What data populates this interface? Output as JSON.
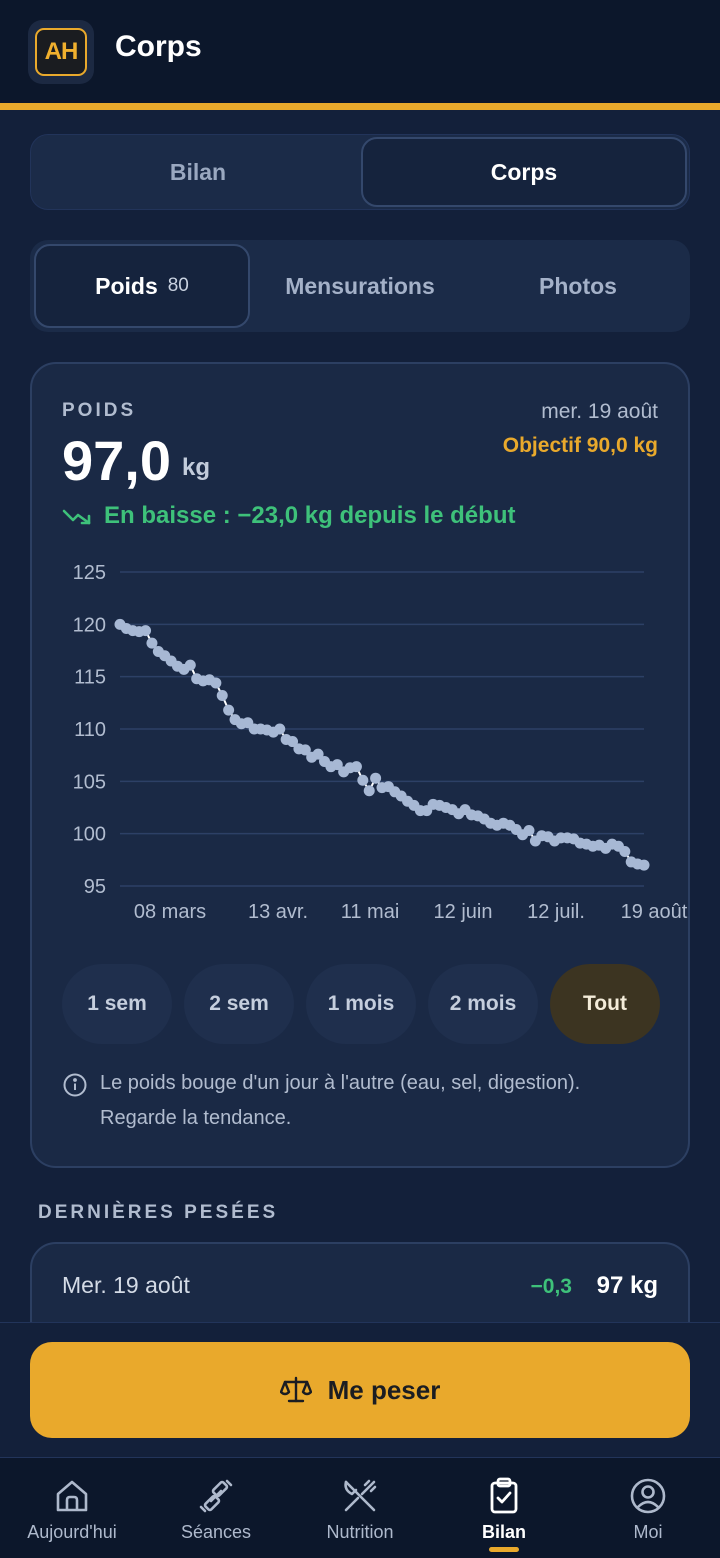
{
  "header": {
    "logo_text": "AH",
    "title": "Corps"
  },
  "top_tabs": [
    {
      "label": "Bilan",
      "active": false
    },
    {
      "label": "Corps",
      "active": true
    }
  ],
  "sub_tabs": [
    {
      "label": "Poids",
      "count": "80",
      "active": true
    },
    {
      "label": "Mensurations",
      "active": false
    },
    {
      "label": "Photos",
      "active": false
    }
  ],
  "card": {
    "label": "POIDS",
    "value": "97,0",
    "unit": "kg",
    "date": "mer. 19 août",
    "goal": "Objectif 90,0 kg",
    "trend": "En baisse : −23,0 kg depuis le début",
    "info": "Le poids bouge d'un jour à l'autre (eau, sel, digestion). Regarde la tendance."
  },
  "ranges": [
    {
      "label": "1 sem",
      "active": false
    },
    {
      "label": "2 sem",
      "active": false
    },
    {
      "label": "1 mois",
      "active": false
    },
    {
      "label": "2 mois",
      "active": false
    },
    {
      "label": "Tout",
      "active": true
    }
  ],
  "chart_data": {
    "type": "line",
    "ylim": [
      95,
      125
    ],
    "yticks": [
      125,
      120,
      115,
      110,
      105,
      100,
      95
    ],
    "xtick_labels": [
      "08 mars",
      "13 avr.",
      "11 mai",
      "12 juin",
      "12 juil.",
      "19 août"
    ],
    "xtick_days": [
      0,
      36,
      64,
      96,
      126,
      164
    ],
    "x_range": [
      0,
      170
    ],
    "values": [
      120.0,
      119.6,
      119.4,
      119.3,
      119.4,
      118.2,
      117.4,
      117.0,
      116.5,
      116.0,
      115.7,
      116.1,
      114.8,
      114.6,
      114.7,
      114.4,
      113.2,
      111.8,
      110.9,
      110.5,
      110.6,
      110.0,
      110.0,
      109.9,
      109.7,
      110.0,
      109.0,
      108.8,
      108.1,
      108.0,
      107.3,
      107.6,
      106.9,
      106.4,
      106.6,
      105.9,
      106.3,
      106.4,
      105.1,
      104.1,
      105.3,
      104.4,
      104.5,
      104.0,
      103.6,
      103.1,
      102.7,
      102.2,
      102.2,
      102.8,
      102.7,
      102.5,
      102.3,
      101.9,
      102.3,
      101.8,
      101.7,
      101.4,
      101.0,
      100.8,
      101.0,
      100.8,
      100.4,
      99.9,
      100.3,
      99.3,
      99.8,
      99.7,
      99.3,
      99.6,
      99.6,
      99.5,
      99.1,
      99.0,
      98.8,
      98.9,
      98.6,
      99.0,
      98.8,
      98.3,
      97.3,
      97.1,
      97.0
    ]
  },
  "latest": {
    "title": "DERNIÈRES PESÉES",
    "entries": [
      {
        "date": "Mer. 19 août",
        "delta": "−0,3",
        "value": "97 kg"
      }
    ]
  },
  "cta": {
    "label": "Me peser"
  },
  "nav": [
    {
      "label": "Aujourd'hui",
      "icon": "home-icon",
      "active": false
    },
    {
      "label": "Séances",
      "icon": "dumbbell-icon",
      "active": false
    },
    {
      "label": "Nutrition",
      "icon": "utensils-icon",
      "active": false
    },
    {
      "label": "Bilan",
      "icon": "clipboard-check-icon",
      "active": true
    },
    {
      "label": "Moi",
      "icon": "user-circle-icon",
      "active": false
    }
  ],
  "colors": {
    "accent": "#e9a92c",
    "positive": "#3ec17a",
    "line": "#a7b8d4",
    "background": "#13203a"
  }
}
